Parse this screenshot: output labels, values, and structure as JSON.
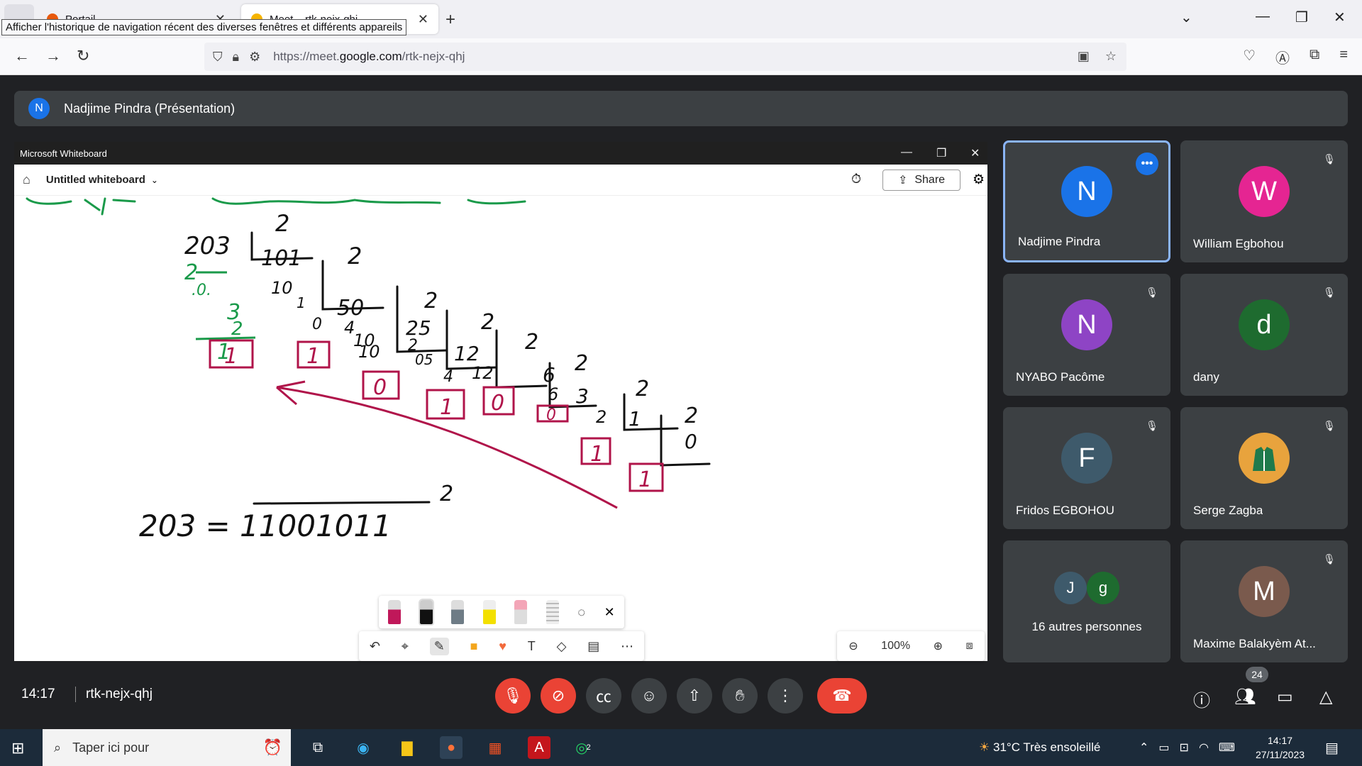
{
  "browser": {
    "tabs": [
      {
        "label": "Portail"
      },
      {
        "label": "Meet – rtk-nejx-qhj"
      }
    ],
    "tooltip": "Afficher l'historique de navigation récent des diverses fenêtres et différents appareils",
    "url_prefix": "https://meet.",
    "url_domain": "google.com",
    "url_path": "/rtk-nejx-qhj"
  },
  "meet": {
    "presentation_title": "Nadjime Pindra (Présentation)",
    "presenter_initial": "N",
    "clock": "14:17",
    "meeting_code": "rtk-nejx-qhj",
    "participant_count": "24",
    "participants": [
      {
        "initial": "N",
        "name": "Nadjime Pindra",
        "color": "#1a73e8"
      },
      {
        "initial": "W",
        "name": "William Egbohou",
        "color": "#e52592"
      },
      {
        "initial": "N",
        "name": "NYABO Pacôme",
        "color": "#8e44c5"
      },
      {
        "initial": "d",
        "name": "dany",
        "color": "#1e6b2f"
      },
      {
        "initial": "F",
        "name": "Fridos EGBOHOU",
        "color": "#3e5a6b"
      },
      {
        "initial": "",
        "name": "Serge Zagba",
        "color": "#e8a33d"
      },
      {
        "initial": "M",
        "name": "Maxime Balakyèm At...",
        "color": "#7a5a4d"
      }
    ],
    "others": {
      "label": "16 autres personnes",
      "a": "J",
      "b": "g"
    }
  },
  "whiteboard": {
    "window_title": "Microsoft Whiteboard",
    "board_name": "Untitled whiteboard",
    "share_label": "Share",
    "zoom": "100%",
    "equation": "203 = 11001011",
    "base": "2"
  },
  "taskbar": {
    "search_placeholder": "Taper ici pour",
    "weather": "31°C  Très ensoleillé",
    "time": "14:17",
    "date": "27/11/2023",
    "whatsapp_badge": "2"
  }
}
